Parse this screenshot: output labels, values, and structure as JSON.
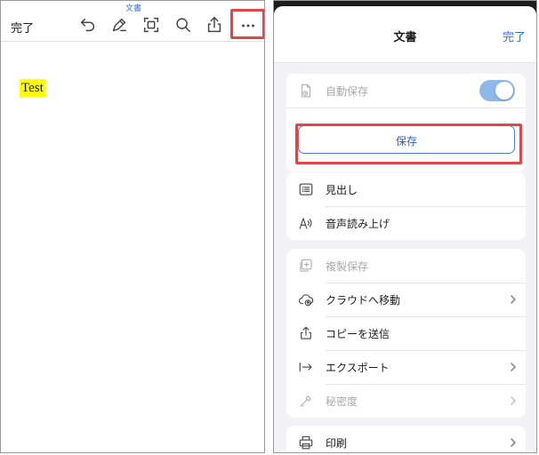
{
  "left": {
    "doc_title": "文書",
    "done_label": "完了",
    "toolbar_icons": [
      "undo-icon",
      "pen-icon",
      "scan-icon",
      "search-icon",
      "share-icon",
      "more-icon"
    ],
    "document_text": "Test",
    "highlight_color": "#ffff00"
  },
  "right": {
    "sheet_title": "文書",
    "done_label": "完了",
    "autosave": {
      "label": "自動保存",
      "enabled": true
    },
    "save_button_label": "保存",
    "group2": [
      {
        "label": "見出し",
        "icon": "list-icon"
      },
      {
        "label": "音声読み上げ",
        "icon": "read-aloud-icon"
      }
    ],
    "group3": [
      {
        "label": "複製保存",
        "icon": "duplicate-icon",
        "disabled": true,
        "chevron": false
      },
      {
        "label": "クラウドへ移動",
        "icon": "cloud-upload-icon",
        "disabled": false,
        "chevron": true
      },
      {
        "label": "コピーを送信",
        "icon": "share-icon",
        "disabled": false,
        "chevron": false
      },
      {
        "label": "エクスポート",
        "icon": "export-icon",
        "disabled": false,
        "chevron": true
      },
      {
        "label": "秘密度",
        "icon": "sensitivity-icon",
        "disabled": true,
        "chevron": true
      }
    ],
    "group4": [
      {
        "label": "印刷",
        "icon": "print-icon",
        "chevron": true
      }
    ]
  },
  "colors": {
    "accent": "#2a6fe0",
    "annotation_red": "#e0464c",
    "toggle_on": "#8fb8ea",
    "disabled_text": "#a9a9ae"
  }
}
